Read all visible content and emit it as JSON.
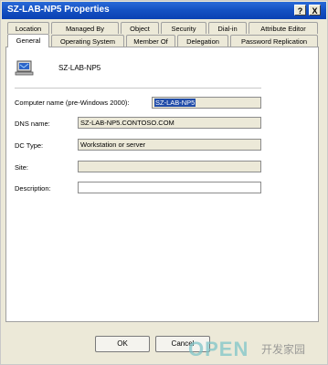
{
  "window": {
    "title": "SZ-LAB-NP5 Properties",
    "help_button": "?",
    "close_button": "X"
  },
  "tabs": {
    "row1": [
      "Location",
      "Managed By",
      "Object",
      "Security",
      "Dial-in",
      "Attribute Editor"
    ],
    "row2": [
      "General",
      "Operating System",
      "Member Of",
      "Delegation",
      "Password Replication"
    ],
    "active": "General"
  },
  "general": {
    "object_name": "SZ-LAB-NP5",
    "computer_name_label": "Computer name (pre-Windows 2000):",
    "computer_name_value": "SZ-LAB-NP5",
    "dns_name_label": "DNS name:",
    "dns_name_value": "SZ-LAB-NP5.CONTOSO.COM",
    "dc_type_label": "DC Type:",
    "dc_type_value": "Workstation or server",
    "site_label": "Site:",
    "site_value": "",
    "description_label": "Description:",
    "description_value": ""
  },
  "buttons": {
    "ok": "OK",
    "cancel": "Cancel"
  },
  "watermark": {
    "brand": "OPEN",
    "cjk": "开发家园"
  }
}
